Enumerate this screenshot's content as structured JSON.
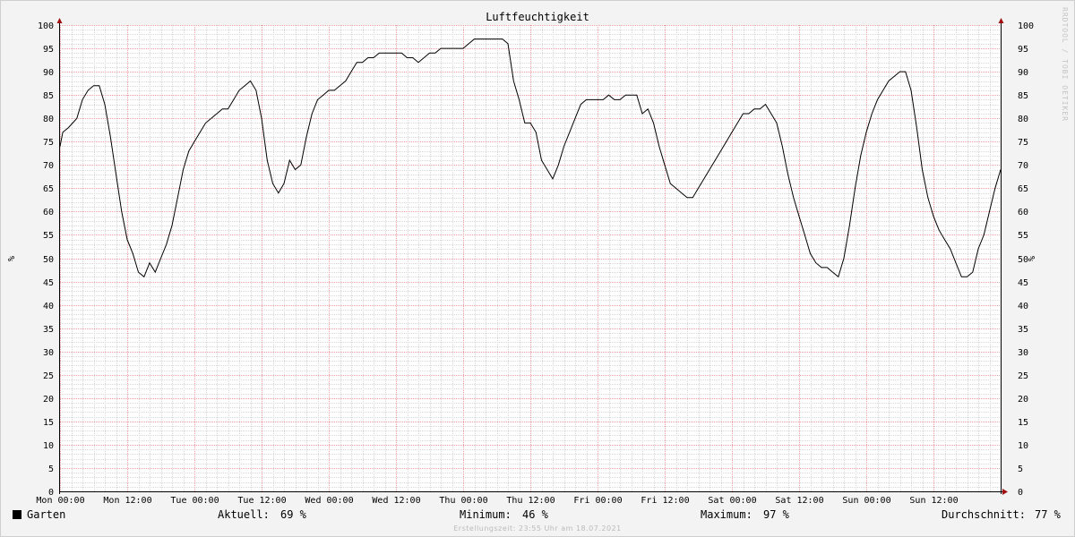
{
  "chart_data": {
    "type": "line",
    "title": "Luftfeuchtigkeit",
    "ylabel_left": "%",
    "ylabel_right": "%",
    "ylim": [
      0,
      100
    ],
    "y_ticks": [
      0,
      5,
      10,
      15,
      20,
      25,
      30,
      35,
      40,
      45,
      50,
      55,
      60,
      65,
      70,
      75,
      80,
      85,
      90,
      95,
      100
    ],
    "x_tick_labels": [
      "Mon 00:00",
      "Mon 12:00",
      "Tue 00:00",
      "Tue 12:00",
      "Wed 00:00",
      "Wed 12:00",
      "Thu 00:00",
      "Thu 12:00",
      "Fri 00:00",
      "Fri 12:00",
      "Sat 00:00",
      "Sat 12:00",
      "Sun 00:00",
      "Sun 12:00"
    ],
    "x_range_hours": [
      0,
      168
    ],
    "grid": true,
    "series": [
      {
        "name": "Garten",
        "color": "#000000",
        "points": [
          [
            0,
            74
          ],
          [
            0.5,
            77
          ],
          [
            1.5,
            78
          ],
          [
            3,
            80
          ],
          [
            4,
            84
          ],
          [
            5,
            86
          ],
          [
            6,
            87
          ],
          [
            7,
            87
          ],
          [
            8,
            83
          ],
          [
            9,
            76
          ],
          [
            10,
            68
          ],
          [
            11,
            60
          ],
          [
            12,
            54
          ],
          [
            13,
            51
          ],
          [
            14,
            47
          ],
          [
            15,
            46
          ],
          [
            16,
            49
          ],
          [
            17,
            47
          ],
          [
            18,
            50
          ],
          [
            19,
            53
          ],
          [
            20,
            57
          ],
          [
            21,
            63
          ],
          [
            22,
            69
          ],
          [
            23,
            73
          ],
          [
            24,
            75
          ],
          [
            25,
            77
          ],
          [
            26,
            79
          ],
          [
            27,
            80
          ],
          [
            28,
            81
          ],
          [
            29,
            82
          ],
          [
            30,
            82
          ],
          [
            31,
            84
          ],
          [
            32,
            86
          ],
          [
            33,
            87
          ],
          [
            34,
            88
          ],
          [
            35,
            86
          ],
          [
            36,
            80
          ],
          [
            37,
            71
          ],
          [
            38,
            66
          ],
          [
            39,
            64
          ],
          [
            40,
            66
          ],
          [
            41,
            71
          ],
          [
            42,
            69
          ],
          [
            43,
            70
          ],
          [
            44,
            76
          ],
          [
            45,
            81
          ],
          [
            46,
            84
          ],
          [
            47,
            85
          ],
          [
            48,
            86
          ],
          [
            49,
            86
          ],
          [
            50,
            87
          ],
          [
            51,
            88
          ],
          [
            52,
            90
          ],
          [
            53,
            92
          ],
          [
            54,
            92
          ],
          [
            55,
            93
          ],
          [
            56,
            93
          ],
          [
            57,
            94
          ],
          [
            58,
            94
          ],
          [
            60,
            94
          ],
          [
            61,
            94
          ],
          [
            62,
            93
          ],
          [
            63,
            93
          ],
          [
            64,
            92
          ],
          [
            65,
            93
          ],
          [
            66,
            94
          ],
          [
            67,
            94
          ],
          [
            68,
            95
          ],
          [
            70,
            95
          ],
          [
            72,
            95
          ],
          [
            73,
            96
          ],
          [
            74,
            97
          ],
          [
            76,
            97
          ],
          [
            78,
            97
          ],
          [
            79,
            97
          ],
          [
            80,
            96
          ],
          [
            81,
            88
          ],
          [
            82,
            84
          ],
          [
            83,
            79
          ],
          [
            84,
            79
          ],
          [
            85,
            77
          ],
          [
            86,
            71
          ],
          [
            87,
            69
          ],
          [
            88,
            67
          ],
          [
            89,
            70
          ],
          [
            90,
            74
          ],
          [
            91,
            77
          ],
          [
            92,
            80
          ],
          [
            93,
            83
          ],
          [
            94,
            84
          ],
          [
            96,
            84
          ],
          [
            97,
            84
          ],
          [
            98,
            85
          ],
          [
            99,
            84
          ],
          [
            100,
            84
          ],
          [
            101,
            85
          ],
          [
            102,
            85
          ],
          [
            103,
            85
          ],
          [
            104,
            81
          ],
          [
            105,
            82
          ],
          [
            106,
            79
          ],
          [
            107,
            74
          ],
          [
            108,
            70
          ],
          [
            109,
            66
          ],
          [
            110,
            65
          ],
          [
            111,
            64
          ],
          [
            112,
            63
          ],
          [
            113,
            63
          ],
          [
            114,
            65
          ],
          [
            115,
            67
          ],
          [
            116,
            69
          ],
          [
            117,
            71
          ],
          [
            118,
            73
          ],
          [
            119,
            75
          ],
          [
            120,
            77
          ],
          [
            121,
            79
          ],
          [
            122,
            81
          ],
          [
            123,
            81
          ],
          [
            124,
            82
          ],
          [
            125,
            82
          ],
          [
            126,
            83
          ],
          [
            127,
            81
          ],
          [
            128,
            79
          ],
          [
            129,
            74
          ],
          [
            130,
            68
          ],
          [
            131,
            63
          ],
          [
            132,
            59
          ],
          [
            133,
            55
          ],
          [
            134,
            51
          ],
          [
            135,
            49
          ],
          [
            136,
            48
          ],
          [
            137,
            48
          ],
          [
            138,
            47
          ],
          [
            139,
            46
          ],
          [
            140,
            50
          ],
          [
            141,
            57
          ],
          [
            142,
            65
          ],
          [
            143,
            72
          ],
          [
            144,
            77
          ],
          [
            145,
            81
          ],
          [
            146,
            84
          ],
          [
            147,
            86
          ],
          [
            148,
            88
          ],
          [
            149,
            89
          ],
          [
            150,
            90
          ],
          [
            151,
            90
          ],
          [
            152,
            86
          ],
          [
            153,
            78
          ],
          [
            154,
            69
          ],
          [
            155,
            63
          ],
          [
            156,
            59
          ],
          [
            157,
            56
          ],
          [
            158,
            54
          ],
          [
            159,
            52
          ],
          [
            160,
            49
          ],
          [
            161,
            46
          ],
          [
            162,
            46
          ],
          [
            163,
            47
          ],
          [
            164,
            52
          ],
          [
            165,
            55
          ],
          [
            166,
            60
          ],
          [
            167,
            65
          ],
          [
            168,
            69
          ]
        ]
      }
    ]
  },
  "legend": {
    "series_name": "Garten",
    "series_color": "#000000",
    "current_label": "Aktuell:",
    "current_value": "69 %",
    "min_label": "Minimum:",
    "min_value": "46 %",
    "max_label": "Maximum:",
    "max_value": "97 %",
    "avg_label": "Durchschnitt:",
    "avg_value": "77 %"
  },
  "footer": "Erstellungszeit: 23:55 Uhr am 18.07.2021",
  "watermark": "RRDTOOL / TOBI OETIKER",
  "colors": {
    "background": "#f3f3f3",
    "plot_background": "#ffffff",
    "major_grid": "#e8a0a0",
    "minor_grid": "#d8d8d8",
    "axis": "#000000",
    "arrow": "#a01010"
  }
}
